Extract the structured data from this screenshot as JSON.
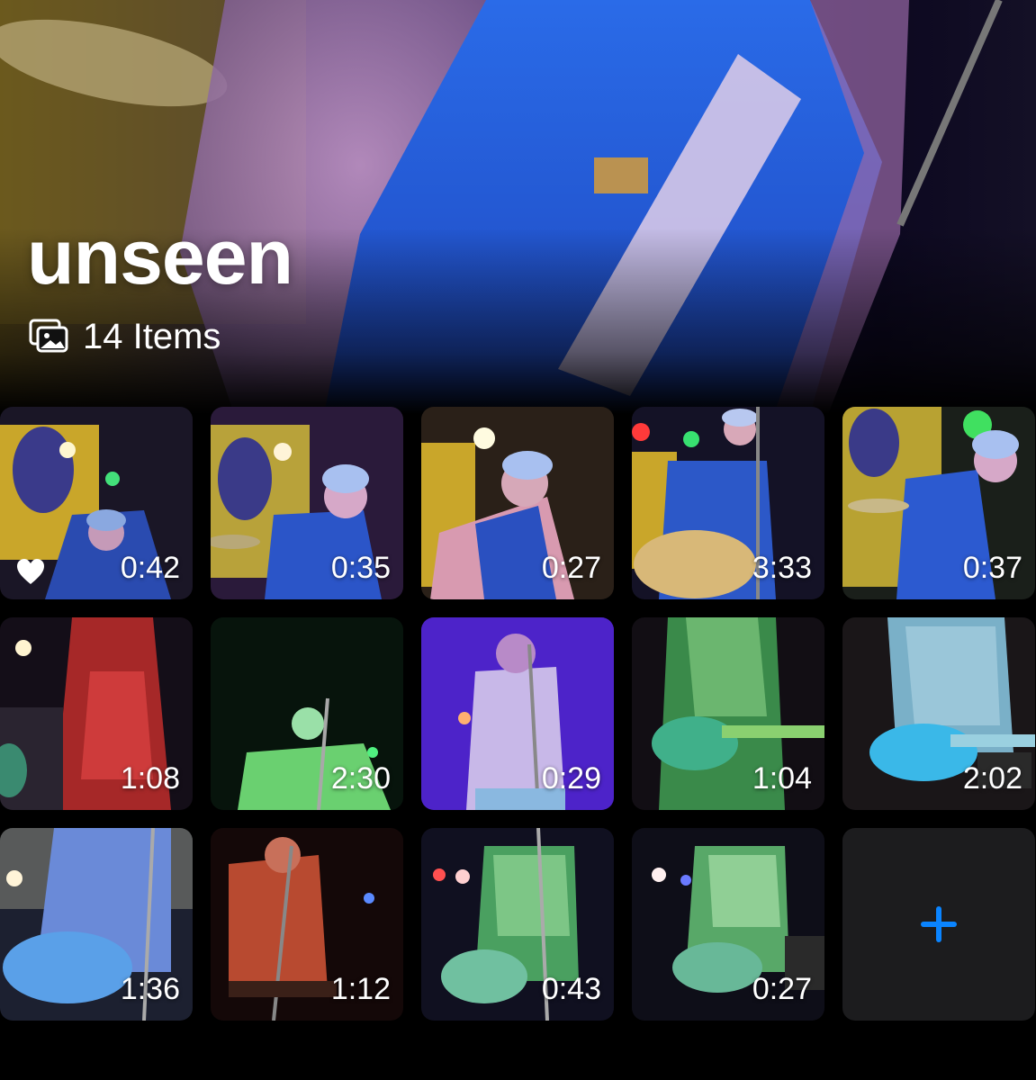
{
  "album": {
    "title": "unseen",
    "count_label": "14 Items"
  },
  "icons": {
    "album_meta": "photo-stack-icon",
    "favorite": "heart-icon",
    "add": "plus-icon"
  },
  "colors": {
    "accent": "#0a84ff",
    "add_tile_bg": "#1c1c1e",
    "background": "#000000"
  },
  "items": [
    {
      "duration": "0:42",
      "favorite": true
    },
    {
      "duration": "0:35",
      "favorite": false
    },
    {
      "duration": "0:27",
      "favorite": false
    },
    {
      "duration": "3:33",
      "favorite": false
    },
    {
      "duration": "0:37",
      "favorite": false
    },
    {
      "duration": "1:08",
      "favorite": false
    },
    {
      "duration": "2:30",
      "favorite": false
    },
    {
      "duration": "0:29",
      "favorite": false
    },
    {
      "duration": "1:04",
      "favorite": false
    },
    {
      "duration": "2:02",
      "favorite": false
    },
    {
      "duration": "1:36",
      "favorite": false
    },
    {
      "duration": "1:12",
      "favorite": false
    },
    {
      "duration": "0:43",
      "favorite": false
    },
    {
      "duration": "0:27",
      "favorite": false
    }
  ]
}
